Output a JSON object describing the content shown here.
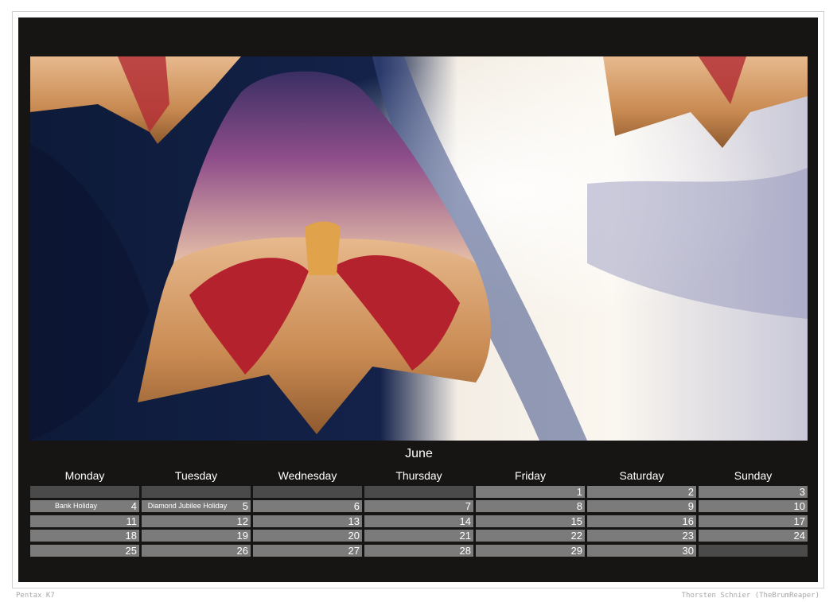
{
  "month": "June",
  "weekdays": [
    "Monday",
    "Tuesday",
    "Wednesday",
    "Thursday",
    "Friday",
    "Saturday",
    "Sunday"
  ],
  "weeks": [
    [
      {
        "day": ""
      },
      {
        "day": ""
      },
      {
        "day": ""
      },
      {
        "day": ""
      },
      {
        "day": "1"
      },
      {
        "day": "2"
      },
      {
        "day": "3"
      }
    ],
    [
      {
        "day": "4",
        "note": "Bank Holiday"
      },
      {
        "day": "5",
        "note": "Diamond Jubilee Holiday"
      },
      {
        "day": "6"
      },
      {
        "day": "7"
      },
      {
        "day": "8"
      },
      {
        "day": "9"
      },
      {
        "day": "10"
      }
    ],
    [
      {
        "day": "11"
      },
      {
        "day": "12"
      },
      {
        "day": "13"
      },
      {
        "day": "14"
      },
      {
        "day": "15"
      },
      {
        "day": "16"
      },
      {
        "day": "17"
      }
    ],
    [
      {
        "day": "18"
      },
      {
        "day": "19"
      },
      {
        "day": "20"
      },
      {
        "day": "21"
      },
      {
        "day": "22"
      },
      {
        "day": "23"
      },
      {
        "day": "24"
      }
    ],
    [
      {
        "day": "25"
      },
      {
        "day": "26"
      },
      {
        "day": "27"
      },
      {
        "day": "28"
      },
      {
        "day": "29"
      },
      {
        "day": "30"
      },
      {
        "day": ""
      }
    ]
  ],
  "footer": {
    "camera": "Pentax K7",
    "credit": "Thorsten Schnier (TheBrumReaper)"
  },
  "colors": {
    "panel": "#161514",
    "cell_filled": "#7b7b7b",
    "cell_empty": "#4a4a4a"
  },
  "photo": {
    "subject": "flower-photo"
  }
}
